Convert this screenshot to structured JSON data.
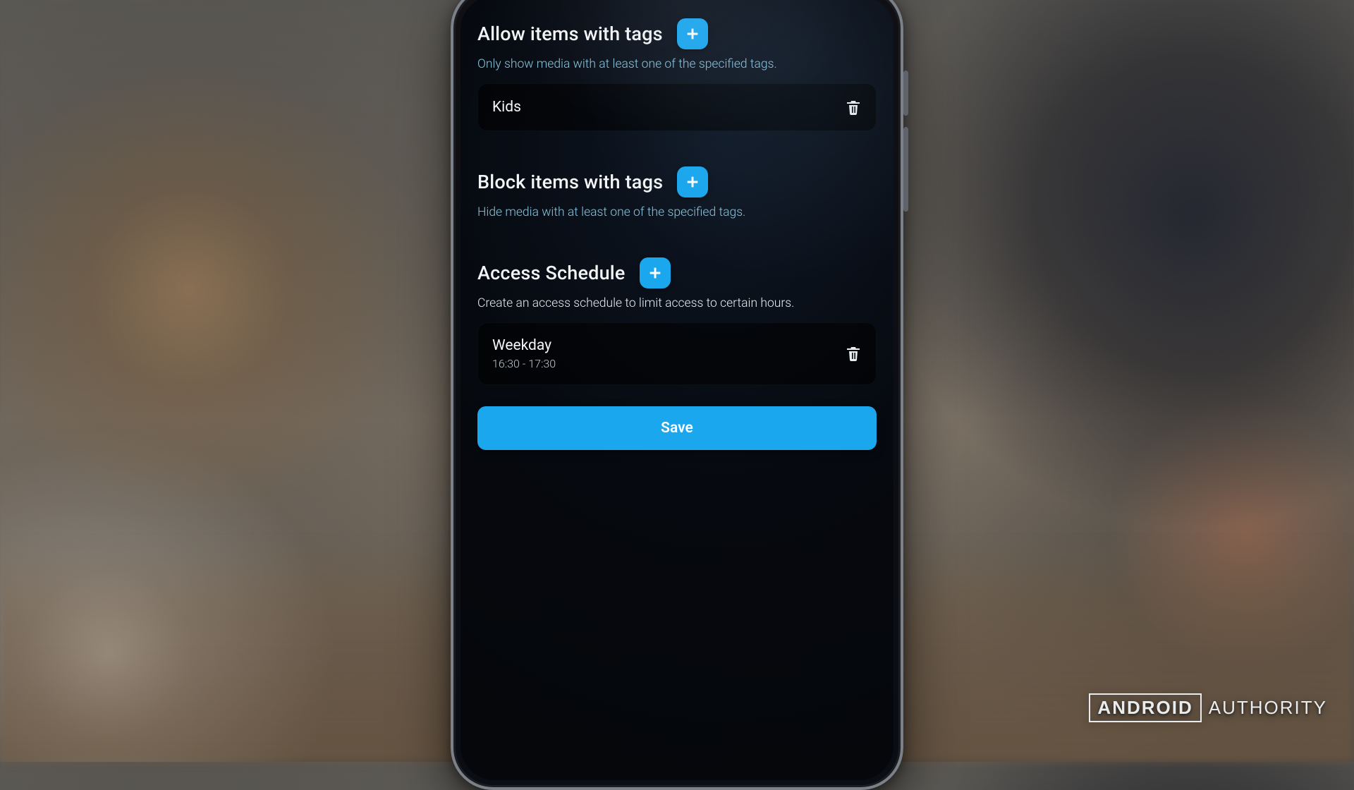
{
  "colors": {
    "accent": "#1aa7ee",
    "hint": "#8ac7e0"
  },
  "sections": {
    "allow": {
      "title": "Allow items with tags",
      "hint": "Only show media with at least one of the specified tags.",
      "items": [
        {
          "label": "Kids"
        }
      ]
    },
    "block": {
      "title": "Block items with tags",
      "hint": "Hide media with at least one of the specified tags.",
      "items": []
    },
    "schedule": {
      "title": "Access Schedule",
      "hint": "Create an access schedule to limit access to certain hours.",
      "items": [
        {
          "label": "Weekday",
          "detail": "16:30 - 17:30"
        }
      ]
    }
  },
  "save_label": "Save",
  "watermark": {
    "brand_boxed": "ANDROID",
    "brand_rest": "AUTHORITY"
  }
}
